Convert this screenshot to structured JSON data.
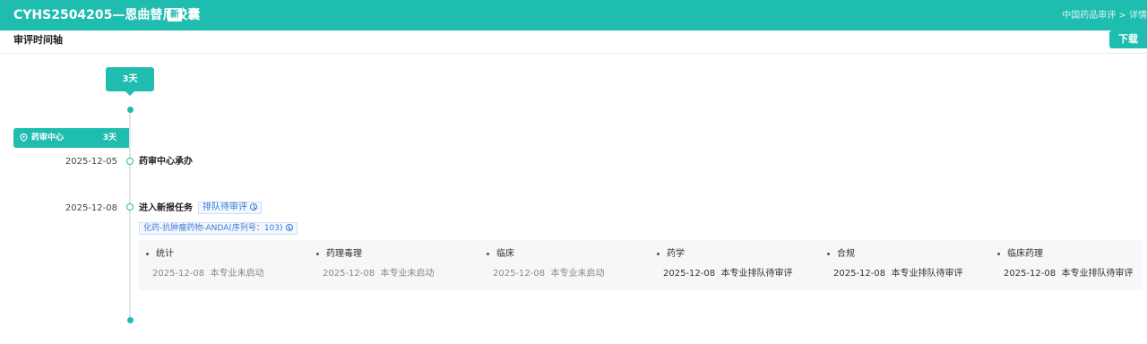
{
  "header": {
    "title": "CYHS2504205—恩曲替尼胶囊",
    "new_badge": "新",
    "breadcrumb": "中国药品审评 > 详情"
  },
  "subbar": {
    "label": "审评时间轴",
    "download": "下载"
  },
  "timeline": {
    "top_bubble": "3天",
    "center": {
      "name": "药审中心",
      "days": "3天"
    },
    "events": [
      {
        "date": "2025-12-05",
        "title": "药审中心承办"
      },
      {
        "date": "2025-12-08",
        "title": "进入新报任务",
        "status": "排队待审评",
        "category": "化药-抗肿瘤药物-ANDA(序列号：103)"
      }
    ],
    "specialties": [
      {
        "name": "统计",
        "date": "2025-12-08",
        "status": "本专业未启动",
        "active": false
      },
      {
        "name": "药理毒理",
        "date": "2025-12-08",
        "status": "本专业未启动",
        "active": false
      },
      {
        "name": "临床",
        "date": "2025-12-08",
        "status": "本专业未启动",
        "active": false
      },
      {
        "name": "药学",
        "date": "2025-12-08",
        "status": "本专业排队待审评",
        "active": true
      },
      {
        "name": "合规",
        "date": "2025-12-08",
        "status": "本专业排队待审评",
        "active": true
      },
      {
        "name": "临床药理",
        "date": "2025-12-08",
        "status": "本专业排队待审评",
        "active": true
      }
    ]
  },
  "colors": {
    "accent": "#1fbcb0",
    "tag_blue": "#3a7bd5",
    "muted": "#8a8a8a"
  }
}
